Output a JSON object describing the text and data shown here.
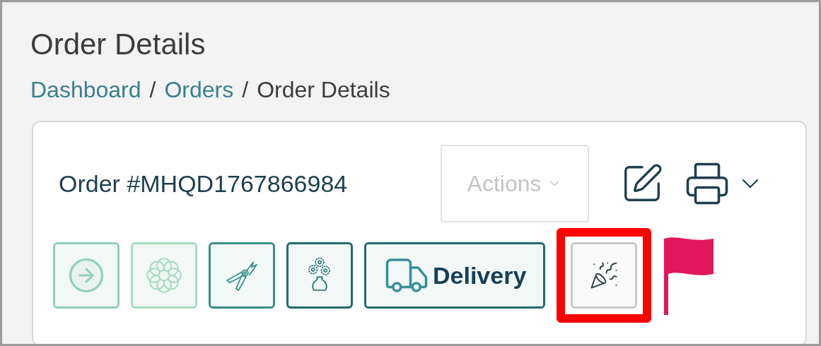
{
  "page": {
    "title": "Order Details"
  },
  "breadcrumb": [
    {
      "label": "Dashboard",
      "kind": "link"
    },
    {
      "label": "/",
      "kind": "separator"
    },
    {
      "label": "Orders",
      "kind": "link"
    },
    {
      "label": "/",
      "kind": "separator"
    },
    {
      "label": "Order Details",
      "kind": "current"
    }
  ],
  "order": {
    "number": "Order #MHQD1767866984",
    "actions": {
      "label": "Actions",
      "disabled": true
    }
  },
  "steps": [
    {
      "kind": "arrow",
      "color": "#8fd0b8",
      "highlighted": false
    },
    {
      "kind": "flower",
      "color": "#a6dcc0",
      "highlighted": false
    },
    {
      "kind": "pruner",
      "color": "#3a8f86",
      "highlighted": false
    },
    {
      "kind": "vase",
      "color": "#1f6b6b",
      "highlighted": false
    },
    {
      "kind": "truck",
      "color": "#1f6b6b",
      "label": "Delivery",
      "highlighted": false
    },
    {
      "kind": "party",
      "color": "#c8c8c8",
      "highlighted": true
    }
  ],
  "flag": {
    "color": "#e0185e"
  }
}
